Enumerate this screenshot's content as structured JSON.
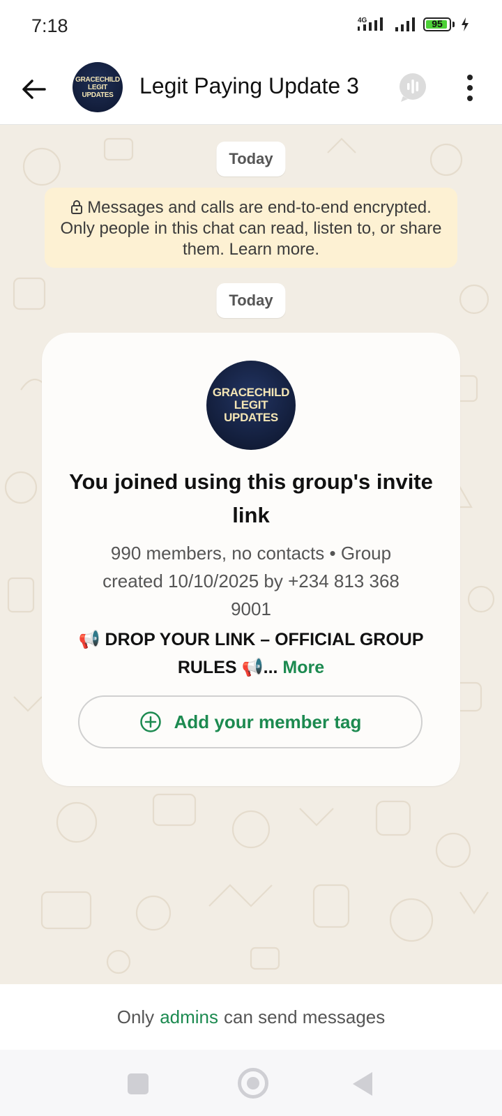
{
  "status_bar": {
    "time": "7:18",
    "network": "4G",
    "battery": "95",
    "battery_level": 0.95
  },
  "header": {
    "title": "Legit Paying Update 3",
    "avatar_line1": "GRACECHILD",
    "avatar_line2": "LEGIT UPDATES",
    "icons": [
      "back-arrow-icon",
      "group-call-icon",
      "more-vert-icon"
    ]
  },
  "chat": {
    "date_chip_1": "Today",
    "encryption_notice": "Messages and calls are end-to-end encrypted. Only people in this chat can read, listen to, or share them. Learn more.",
    "date_chip_2": "Today"
  },
  "group_card": {
    "avatar_line1": "GRACECHILD",
    "avatar_line2": "LEGIT UPDATES",
    "title": "You joined using this group's invite link",
    "subtitle": "990 members, no contacts • Group created 10/10/2025 by +234 813 368 9001",
    "rules_text": "📢 DROP YOUR LINK – OFFICIAL GROUP RULES 📢...",
    "more_label": "More",
    "tag_button_label": "Add your member tag"
  },
  "footer": {
    "prefix": "Only",
    "admins": "admins",
    "suffix": "can send messages"
  },
  "colors": {
    "accent_green": "#1c8a50",
    "chat_background": "#f2ede4",
    "notice_background": "#fdf1d3"
  }
}
